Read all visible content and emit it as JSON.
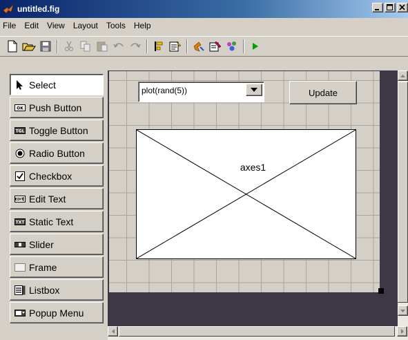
{
  "window": {
    "title": "untitled.fig",
    "controls": {
      "minimize": "minimize-icon",
      "maximize": "maximize-icon",
      "close": "close-icon"
    }
  },
  "menu": [
    "File",
    "Edit",
    "View",
    "Layout",
    "Tools",
    "Help"
  ],
  "toolbar": {
    "icons": [
      "new-file-icon",
      "open-folder-icon",
      "save-icon",
      "cut-icon",
      "copy-icon",
      "paste-icon",
      "undo-icon",
      "redo-icon",
      "align-objects-icon",
      "menu-editor-icon",
      "property-inspector-icon",
      "object-browser-icon",
      "tab-order-icon",
      "run-icon"
    ]
  },
  "palette": {
    "items": [
      {
        "label": "Select",
        "icon": "arrow-cursor-icon",
        "selected": true
      },
      {
        "label": "Push Button",
        "icon": "push-button-icon",
        "badge": "OK"
      },
      {
        "label": "Toggle Button",
        "icon": "toggle-button-icon",
        "badge": "TGL"
      },
      {
        "label": "Radio Button",
        "icon": "radio-button-icon"
      },
      {
        "label": "Checkbox",
        "icon": "checkbox-icon"
      },
      {
        "label": "Edit Text",
        "icon": "edit-text-icon",
        "badge": "EDIT"
      },
      {
        "label": "Static Text",
        "icon": "static-text-icon",
        "badge": "TXT"
      },
      {
        "label": "Slider",
        "icon": "slider-icon"
      },
      {
        "label": "Frame",
        "icon": "frame-icon"
      },
      {
        "label": "Listbox",
        "icon": "listbox-icon"
      },
      {
        "label": "Popup Menu",
        "icon": "popup-menu-icon"
      }
    ]
  },
  "canvas": {
    "popup_value": "plot(rand(5))",
    "update_label": "Update",
    "axes_label": "axes1"
  },
  "colors": {
    "title_bar": "#0a246a",
    "face": "#d4d0c8",
    "layout_border": "#3e3846",
    "run_green": "#00a000"
  }
}
